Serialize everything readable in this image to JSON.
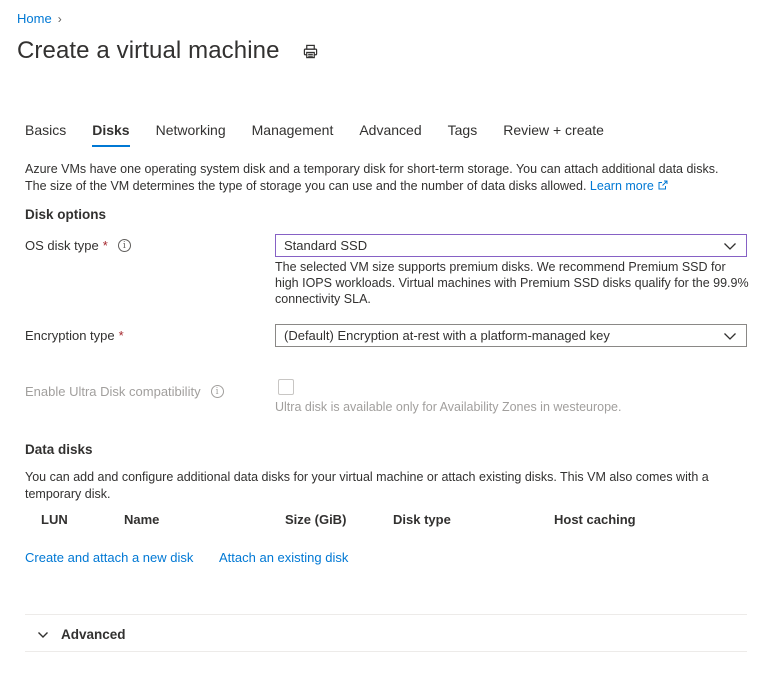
{
  "breadcrumb": {
    "home": "Home",
    "separator": "›"
  },
  "header": {
    "title": "Create a virtual machine",
    "print_icon": "print-icon"
  },
  "tabs": [
    {
      "label": "Basics",
      "active": false
    },
    {
      "label": "Disks",
      "active": true
    },
    {
      "label": "Networking",
      "active": false
    },
    {
      "label": "Management",
      "active": false
    },
    {
      "label": "Advanced",
      "active": false
    },
    {
      "label": "Tags",
      "active": false
    },
    {
      "label": "Review + create",
      "active": false
    }
  ],
  "intro": {
    "line1": "Azure VMs have one operating system disk and a temporary disk for short-term storage. You can attach additional data disks.",
    "line2": "The size of the VM determines the type of storage you can use and the number of data disks allowed.",
    "learn_more": "Learn more"
  },
  "disk_options": {
    "heading": "Disk options",
    "os_disk_type": {
      "label": "OS disk type",
      "required": "*",
      "value": "Standard SSD",
      "help": "The selected VM size supports premium disks. We recommend Premium SSD for high IOPS workloads. Virtual machines with Premium SSD disks qualify for the 99.9% connectivity SLA."
    },
    "encryption_type": {
      "label": "Encryption type",
      "required": "*",
      "value": "(Default) Encryption at-rest with a platform-managed key"
    },
    "ultra_disk": {
      "label": "Enable Ultra Disk compatibility",
      "checked": false,
      "help": "Ultra disk is available only for Availability Zones in westeurope."
    }
  },
  "data_disks": {
    "heading": "Data disks",
    "description": "You can add and configure additional data disks for your virtual machine or attach existing disks. This VM also comes with a temporary disk.",
    "columns": [
      "LUN",
      "Name",
      "Size (GiB)",
      "Disk type",
      "Host caching"
    ],
    "create_link": "Create and attach a new disk",
    "attach_link": "Attach an existing disk"
  },
  "advanced_section": {
    "label": "Advanced",
    "expanded": false
  },
  "colors": {
    "accent": "#0078d4",
    "required": "#a4262c",
    "focus_border": "#8661c5"
  }
}
